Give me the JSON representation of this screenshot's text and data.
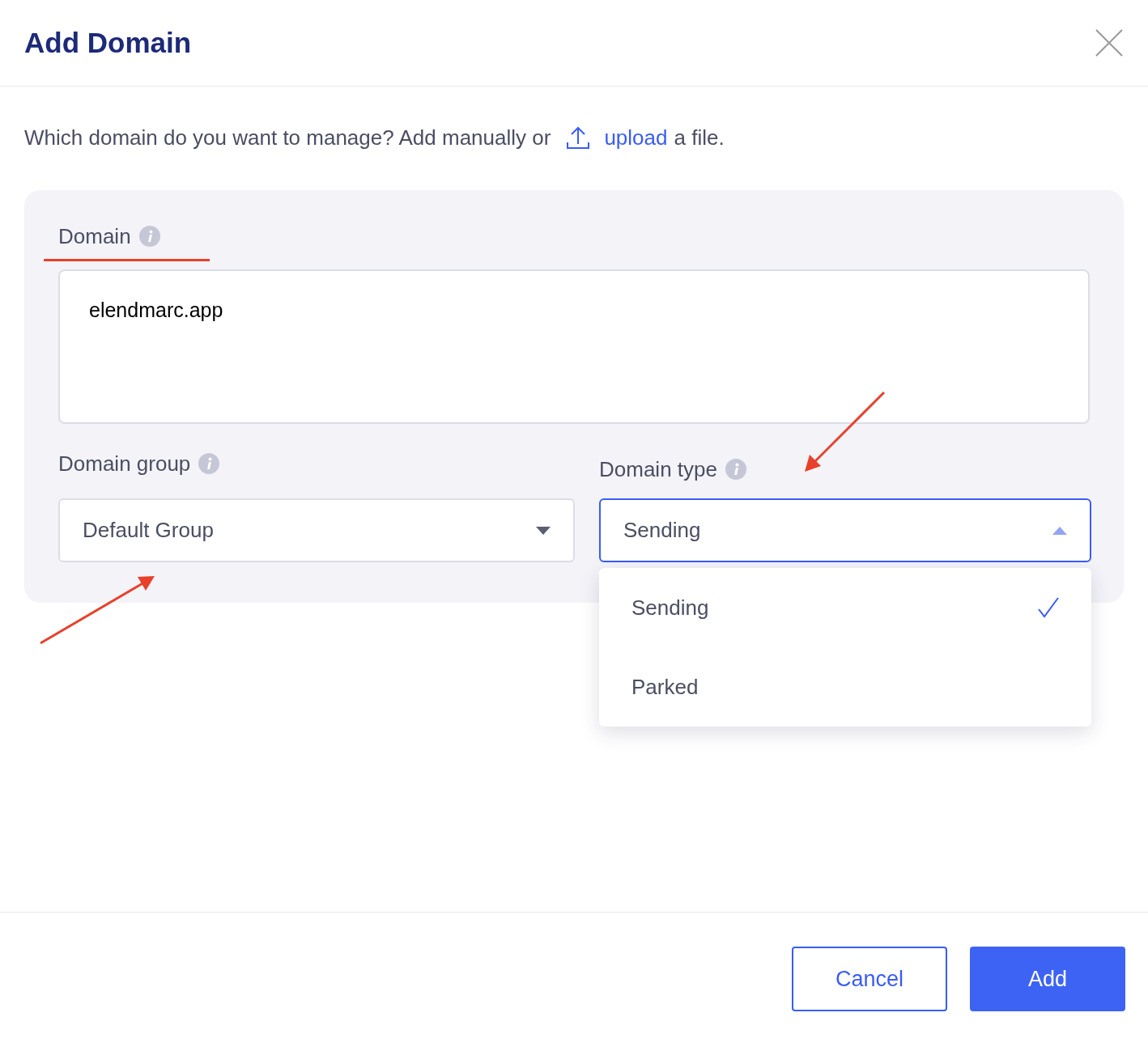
{
  "dialog": {
    "title": "Add Domain"
  },
  "intro": {
    "text_before": "Which domain do you want to manage? Add manually or",
    "link": "upload",
    "text_after": "a file."
  },
  "fields": [
    {
      "kind": "textarea",
      "label": "Domain",
      "value": "elendmarc.app"
    },
    {
      "kind": "select",
      "label": "Domain group",
      "value": "Default Group",
      "expanded": false
    },
    {
      "kind": "select",
      "label": "Domain type",
      "value": "Sending",
      "expanded": true,
      "options": [
        {
          "label": "Sending",
          "selected": true
        },
        {
          "label": "Parked",
          "selected": false
        }
      ]
    }
  ],
  "buttons": [
    {
      "kind": "secondary",
      "label": "Cancel"
    },
    {
      "kind": "primary",
      "label": "Add"
    }
  ]
}
